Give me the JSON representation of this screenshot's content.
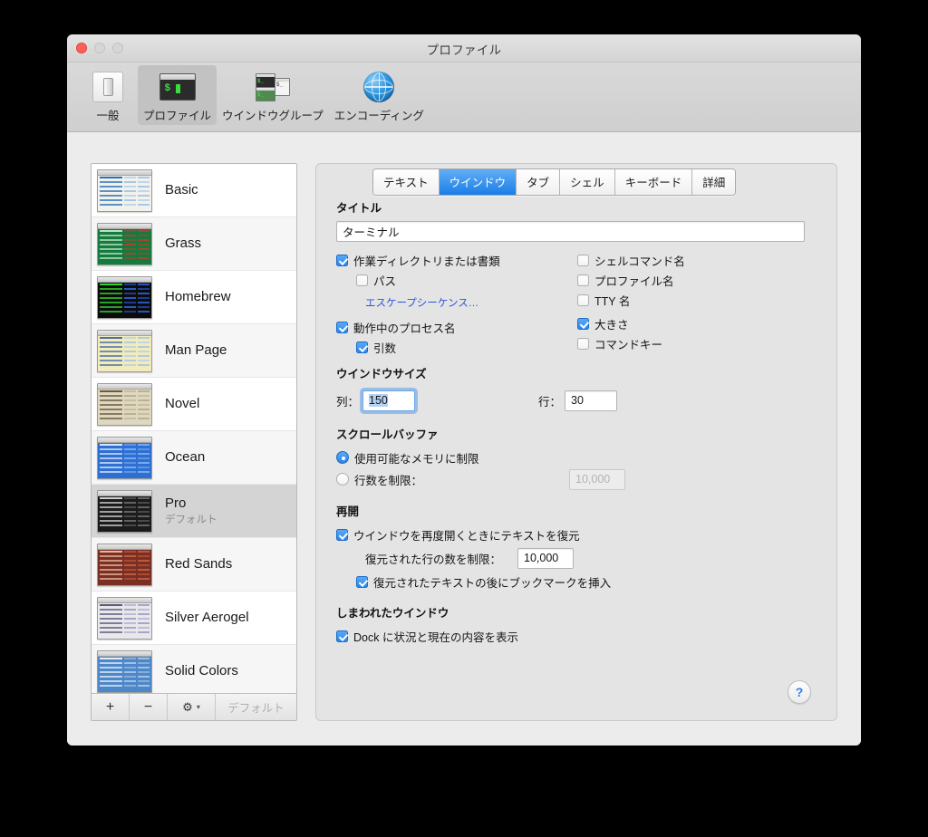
{
  "window": {
    "title": "プロファイル",
    "traffic_lights": [
      "close",
      "minimize",
      "zoom"
    ]
  },
  "toolbar": {
    "items": [
      {
        "label": "一般",
        "icon": "general-prefs-icon",
        "selected": false
      },
      {
        "label": "プロファイル",
        "icon": "terminal-window-icon",
        "selected": true
      },
      {
        "label": "ウインドウグループ",
        "icon": "window-group-icon",
        "selected": false
      },
      {
        "label": "エンコーディング",
        "icon": "globe-icon",
        "selected": false
      }
    ]
  },
  "profile_list": {
    "items": [
      {
        "name": "Basic",
        "subtitle": "",
        "selected": false,
        "bg": "#f2f1ec",
        "fg": "#2b6fb5",
        "accent": "#9fc4e8",
        "header": "#dcdcdc"
      },
      {
        "name": "Grass",
        "subtitle": "",
        "selected": false,
        "bg": "#147a3d",
        "fg": "#b9e3c4",
        "accent": "#b0412f",
        "header": "#0d5c2c"
      },
      {
        "name": "Homebrew",
        "subtitle": "",
        "selected": false,
        "bg": "#0b0b0b",
        "fg": "#2fd52f",
        "accent": "#2b5fd8",
        "header": "#1a1a1a"
      },
      {
        "name": "Man Page",
        "subtitle": "",
        "selected": false,
        "bg": "#f2ecbd",
        "fg": "#4a6fa5",
        "accent": "#a8c6e4",
        "header": "#ded7a8"
      },
      {
        "name": "Novel",
        "subtitle": "",
        "selected": false,
        "bg": "#dfd8c0",
        "fg": "#6b5a3e",
        "accent": "#b8ac8a",
        "header": "#cfc6ab"
      },
      {
        "name": "Ocean",
        "subtitle": "",
        "selected": false,
        "bg": "#2e6fd4",
        "fg": "#d7e6fb",
        "accent": "#7fb0ec",
        "header": "#2459ad"
      },
      {
        "name": "Pro",
        "subtitle": "デフォルト",
        "selected": true,
        "bg": "#1b1b1b",
        "fg": "#cfcfcf",
        "accent": "#6a6a6a",
        "header": "#2e2e2e"
      },
      {
        "name": "Red Sands",
        "subtitle": "",
        "selected": false,
        "bg": "#7a2f24",
        "fg": "#e8b79a",
        "accent": "#c4603f",
        "header": "#5f241b"
      },
      {
        "name": "Silver Aerogel",
        "subtitle": "",
        "selected": false,
        "bg": "#e8e8ea",
        "fg": "#5a5a7a",
        "accent": "#9f9fc4",
        "header": "#d2d2d6"
      },
      {
        "name": "Solid Colors",
        "subtitle": "",
        "selected": false,
        "bg": "#4e87c7",
        "fg": "#e4eefb",
        "accent": "#a8c8ea",
        "header": "#3d6ea8"
      }
    ],
    "toolbar": {
      "add_label": "+",
      "remove_label": "−",
      "gear_label": "⚙",
      "gear_chevron": "▾",
      "default_button_label": "デフォルト"
    }
  },
  "tabs": [
    {
      "label": "テキスト",
      "active": false
    },
    {
      "label": "ウインドウ",
      "active": true
    },
    {
      "label": "タブ",
      "active": false
    },
    {
      "label": "シェル",
      "active": false
    },
    {
      "label": "キーボード",
      "active": false
    },
    {
      "label": "詳細",
      "active": false
    }
  ],
  "sections": {
    "title": {
      "heading": "タイトル",
      "field_value": "ターミナル",
      "checkboxes_left": [
        {
          "label": "作業ディレクトリまたは書類",
          "checked": true,
          "indent": 0
        },
        {
          "label": "パス",
          "checked": false,
          "indent": 1
        }
      ],
      "link_label": "エスケープシーケンス…",
      "checkboxes_left2": [
        {
          "label": "動作中のプロセス名",
          "checked": true,
          "indent": 0
        },
        {
          "label": "引数",
          "checked": true,
          "indent": 1
        }
      ],
      "checkboxes_right": [
        {
          "label": "シェルコマンド名",
          "checked": false
        },
        {
          "label": "プロファイル名",
          "checked": false
        },
        {
          "label": "TTY 名",
          "checked": false
        },
        {
          "label": "大きさ",
          "checked": true
        },
        {
          "label": "コマンドキー",
          "checked": false
        }
      ]
    },
    "window_size": {
      "heading": "ウインドウサイズ",
      "columns_label": "列：",
      "columns_value": "150",
      "columns_focused": true,
      "rows_label": "行：",
      "rows_value": "30"
    },
    "scroll_buffer": {
      "heading": "スクロールバッファ",
      "options": [
        {
          "label": "使用可能なメモリに制限",
          "selected": true
        },
        {
          "label": "行数を制限：",
          "selected": false
        }
      ],
      "limit_value": "10,000",
      "limit_disabled": true
    },
    "resume": {
      "heading": "再開",
      "restore_checkbox": {
        "label": "ウインドウを再度開くときにテキストを復元",
        "checked": true
      },
      "limit_label": "復元された行の数を制限：",
      "limit_value": "10,000",
      "bookmark_checkbox": {
        "label": "復元されたテキストの後にブックマークを挿入",
        "checked": true
      }
    },
    "hidden_window": {
      "heading": "しまわれたウインドウ",
      "dock_checkbox": {
        "label": "Dock に状況と現在の内容を表示",
        "checked": true
      }
    }
  },
  "help_button": {
    "label": "?"
  },
  "colors": {
    "accent_blue": "#1a7ee8",
    "link_blue": "#2d54d8",
    "selection_blue": "#b4d2f3",
    "window_bg": "#ececec",
    "panel_bg": "#e4e4e4"
  }
}
